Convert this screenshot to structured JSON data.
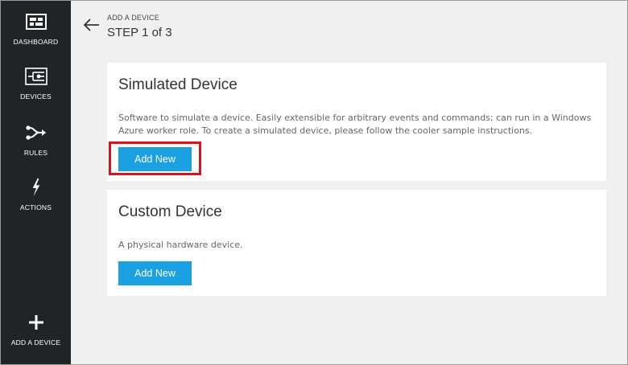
{
  "sidebar": {
    "items": [
      {
        "label": "DASHBOARD",
        "icon": "dashboard-icon"
      },
      {
        "label": "DEVICES",
        "icon": "devices-icon"
      },
      {
        "label": "RULES",
        "icon": "rules-icon"
      },
      {
        "label": "ACTIONS",
        "icon": "lightning-icon"
      }
    ],
    "add_device": {
      "label": "ADD A DEVICE",
      "icon": "plus-icon"
    }
  },
  "header": {
    "kicker": "ADD A DEVICE",
    "step": "STEP 1 of 3"
  },
  "cards": [
    {
      "title": "Simulated Device",
      "description": "Software to simulate a device. Easily extensible for arbitrary events and commands; can run in a Windows Azure worker role. To create a simulated device, please follow the cooler sample instructions.",
      "button_label": "Add New"
    },
    {
      "title": "Custom Device",
      "description": "A physical hardware device.",
      "button_label": "Add New"
    }
  ],
  "colors": {
    "sidebar_bg": "#212426",
    "main_bg": "#f0f0f0",
    "accent": "#1ba1e2",
    "highlight": "#e0101b"
  }
}
